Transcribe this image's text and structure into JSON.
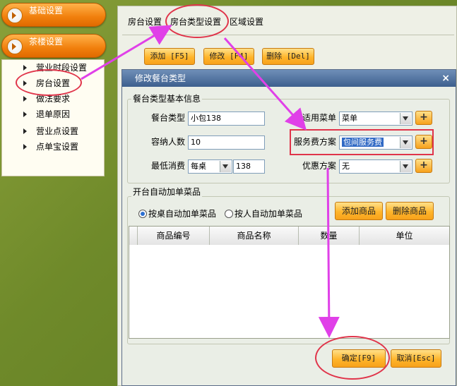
{
  "nav": {
    "btn_basic": "基础设置",
    "btn_teahouse": "茶楼设置",
    "items": [
      "营业时段设置",
      "房台设置",
      "做法要求",
      "退单原因",
      "营业点设置",
      "点单宝设置"
    ]
  },
  "main": {
    "tabs": [
      "房台设置",
      "房台类型设置",
      "区域设置"
    ],
    "toolbar": {
      "add": "添加 [F5]",
      "edit": "修改 [F4]",
      "delete": "删除 [Del]"
    }
  },
  "dialog": {
    "title": "修改餐台类型",
    "close": "×",
    "basic_group": "餐台类型基本信息",
    "type_label": "餐台类型",
    "type_value": "小包138",
    "capacity_label": "容纳人数",
    "capacity_value": "10",
    "min_label": "最低消费",
    "min_unit": "每桌",
    "min_value": "138",
    "menu_label": "适用菜单",
    "menu_value": "菜单",
    "service_label": "服务费方案",
    "service_value": "包间服务费",
    "discount_label": "优惠方案",
    "discount_value": "无",
    "plus": "+",
    "auto_group": "开台自动加单菜品",
    "radio_table": "按桌自动加单菜品",
    "radio_person": "按人自动加单菜品",
    "add_goods": "添加商品",
    "delete_goods": "删除商品",
    "columns": [
      "商品编号",
      "商品名称",
      "数量",
      "单位"
    ],
    "ok": "确定[F9]",
    "cancel": "取消[Esc]"
  },
  "colors": {
    "annotation": "#e0344a",
    "arrow": "#e040e8",
    "title_bar": "#3d5f8e"
  }
}
